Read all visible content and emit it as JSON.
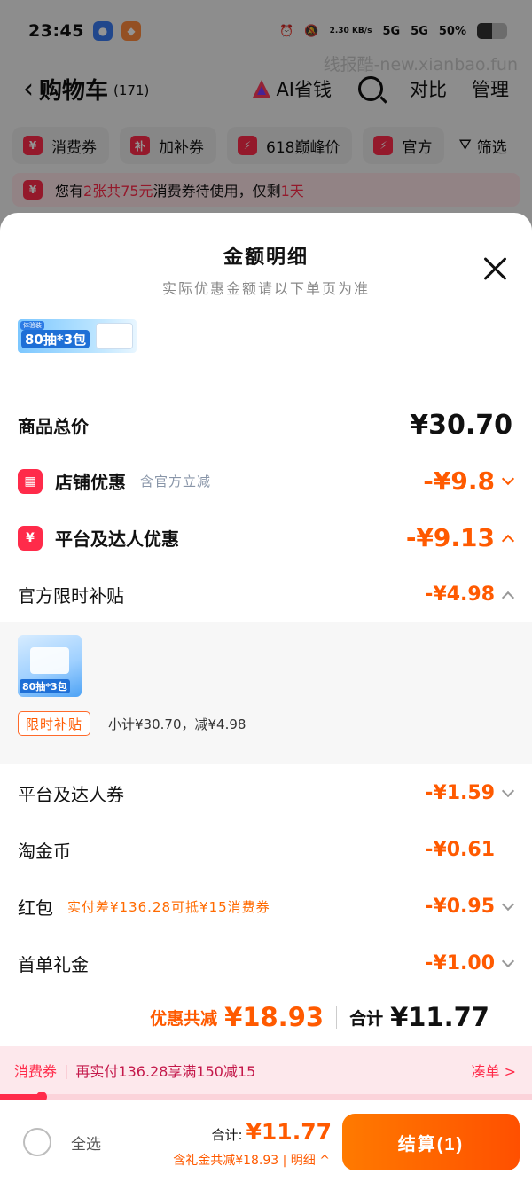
{
  "status_bar": {
    "time": "23:45",
    "net_speed": "2.30 KB/s",
    "signal_1": "5G",
    "signal_2": "5G",
    "battery": "50%"
  },
  "watermark": "线报酷-new.xianbao.fun",
  "nav": {
    "title": "购物车",
    "count": "(171)",
    "ai_label": "AI省钱",
    "compare": "对比",
    "manage": "管理"
  },
  "chips": [
    {
      "badge": "¥",
      "label": "消费券"
    },
    {
      "badge": "补",
      "label": "加补券"
    },
    {
      "badge": "⚡",
      "label": "618巅峰价"
    },
    {
      "badge": "⚡",
      "label": "官方"
    }
  ],
  "filter_label": "筛选",
  "notice": {
    "prefix": "您有",
    "highlight1": "2张共75元",
    "middle": "消费券待使用，仅剩",
    "highlight2": "1天"
  },
  "sheet": {
    "title": "金额明细",
    "subtitle": "实际优惠金额请以下单页为准",
    "product_thumb": {
      "tag": "体验装",
      "big": "80抽*3包"
    },
    "total_label": "商品总价",
    "total_value": "¥30.70",
    "store_discount": {
      "label": "店铺优惠",
      "note": "含官方立减",
      "value": "-¥9.8"
    },
    "platform_discount": {
      "label": "平台及达人优惠",
      "value": "-¥9.13"
    },
    "official_subsidy": {
      "label": "官方限时补贴",
      "value": "-¥4.98"
    },
    "subsidy_detail": {
      "thumb_big": "80抽*3包",
      "tag": "限时补贴",
      "text": "小计¥30.70，减¥4.98"
    },
    "coupon": {
      "label": "平台及达人券",
      "value": "-¥1.59"
    },
    "coins": {
      "label": "淘金币",
      "value": "-¥0.61"
    },
    "redpack": {
      "label": "红包",
      "note": "实付差¥136.28可抵¥15消费券",
      "value": "-¥0.95"
    },
    "first_order": {
      "label": "首单礼金",
      "value": "-¥1.00"
    },
    "summary": {
      "discount_label": "优惠共减",
      "discount_value": "¥18.93",
      "total_label": "合计",
      "total_value": "¥11.77"
    }
  },
  "promo_bar": {
    "tag": "消费券",
    "text": "再实付136.28享满150减15",
    "action": "凑单 >"
  },
  "footer": {
    "select_all": "全选",
    "total_label": "合计:",
    "total_value": "¥11.77",
    "sub_text": "含礼金共减¥18.93 | 明细 ^",
    "checkout": "结算(1)"
  },
  "colors": {
    "accent": "#ff5a00",
    "brand_red": "#ff2b4a"
  }
}
